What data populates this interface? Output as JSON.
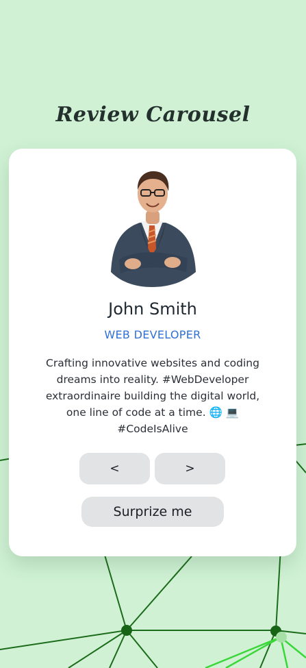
{
  "page": {
    "title": "Review Carousel"
  },
  "review": {
    "name": "John Smith",
    "job": "WEB DEVELOPER",
    "info": "Crafting innovative websites and coding dreams into reality. #WebDeveloper extraordinaire building the digital world, one line of code at a time. 🌐 💻 #CodeIsAlive"
  },
  "controls": {
    "prev_label": "<",
    "next_label": ">",
    "random_label": "Surprize me"
  },
  "colors": {
    "background": "#d0f1d4",
    "card": "#ffffff",
    "job_accent": "#2f6fd6",
    "button": "#e2e3e4",
    "network_line": "#1a6b1a",
    "network_highlight": "#3ad63a"
  },
  "icons": [
    "avatar-photo",
    "network-background"
  ]
}
